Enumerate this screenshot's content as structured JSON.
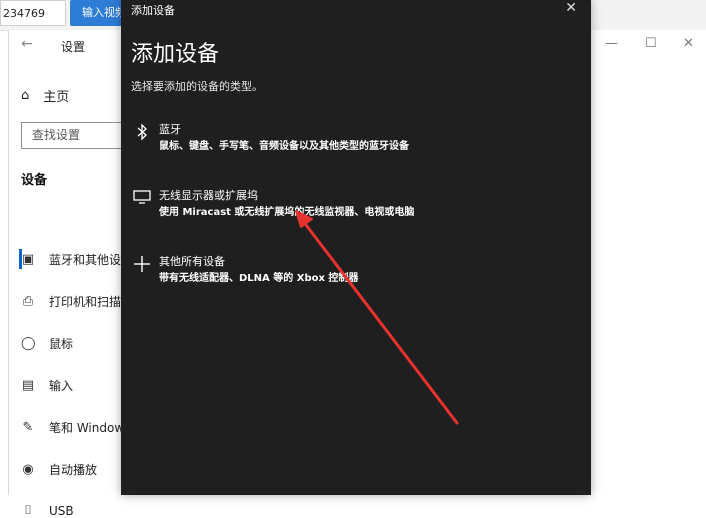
{
  "top_strip": {
    "id_value": "234769",
    "enter_button": "输入视频"
  },
  "settings": {
    "title": "设置",
    "home": "主页",
    "search_placeholder": "查找设置",
    "section": "设备",
    "nav": [
      {
        "icon": "bluetooth-devices-icon",
        "label": "蓝牙和其他设备",
        "active": true
      },
      {
        "icon": "printer-icon",
        "label": "打印机和扫描仪"
      },
      {
        "icon": "mouse-icon",
        "label": "鼠标"
      },
      {
        "icon": "keyboard-icon",
        "label": "输入"
      },
      {
        "icon": "pen-icon",
        "label": "笔和 Windows Ink"
      },
      {
        "icon": "autoplay-icon",
        "label": "自动播放"
      },
      {
        "icon": "usb-icon",
        "label": "USB"
      }
    ]
  },
  "dialog": {
    "titlebar": "添加设备",
    "heading": "添加设备",
    "subtitle": "选择要添加的设备的类型。",
    "options": [
      {
        "icon": "bluetooth-icon",
        "title": "蓝牙",
        "desc": "鼠标、键盘、手写笔、音频设备以及其他类型的蓝牙设备"
      },
      {
        "icon": "monitor-icon",
        "title": "无线显示器或扩展坞",
        "desc": "使用 Miracast 或无线扩展坞的无线监视器、电视或电脑"
      },
      {
        "icon": "plus-icon",
        "title": "其他所有设备",
        "desc": "带有无线适配器、DLNA 等的 Xbox 控制器"
      }
    ]
  },
  "annotation": {
    "color": "#e8322f",
    "points_to": "无线显示器或扩展坞"
  }
}
